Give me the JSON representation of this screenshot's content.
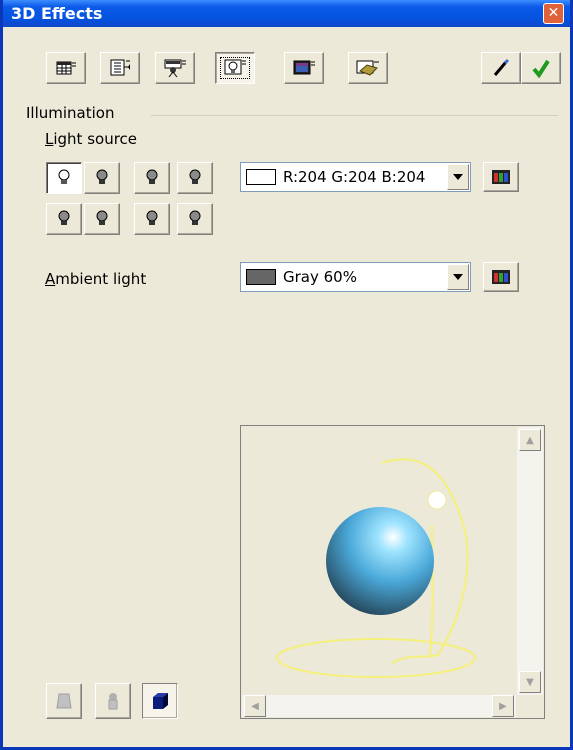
{
  "window": {
    "title": "3D Effects",
    "close_glyph": "✕"
  },
  "toolbar": {
    "buttons": [
      {
        "name": "geometry",
        "icon": "geometry-icon",
        "pressed": false
      },
      {
        "name": "shading",
        "icon": "shading-icon",
        "pressed": false
      },
      {
        "name": "illumination-camera",
        "icon": "projector-icon",
        "pressed": false
      },
      {
        "name": "illumination",
        "icon": "lightbulb-icon",
        "pressed": true
      },
      {
        "name": "textures",
        "icon": "texture-icon",
        "pressed": false
      },
      {
        "name": "material",
        "icon": "material-icon",
        "pressed": false
      }
    ],
    "assign_icon": "pipette-icon",
    "apply_icon": "checkmark-icon"
  },
  "illumination": {
    "heading": "Illumination",
    "light_source_label_prefix": "L",
    "light_source_label_rest": "ight source",
    "light_source_color": "R:204 G:204 B:204",
    "light_source_swatch": "#ffffff",
    "ambient_label_prefix": "A",
    "ambient_label_rest": "mbient light",
    "ambient_color": "Gray 60%",
    "ambient_swatch": "#666666",
    "active_light": 1
  },
  "preview": {
    "sphere_color": "#4aa8d8",
    "light_color": "#f5f07a"
  },
  "colors": {
    "dialog_bg": "#ece9d8",
    "titlebar": "#0553de",
    "apply_green": "#1e9a1e"
  }
}
